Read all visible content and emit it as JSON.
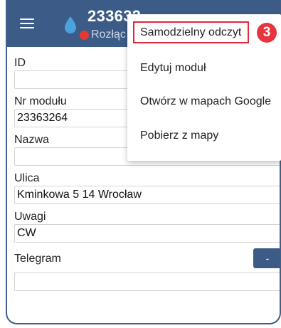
{
  "header": {
    "title": "233632",
    "status": "Rozłąc"
  },
  "form": {
    "id_label": "ID",
    "id_value": "",
    "module_label": "Nr modułu",
    "module_value": "23363264",
    "name_label": "Nazwa",
    "name_value": "",
    "street_label": "Ulica",
    "street_value": "Kminkowa 5 14 Wrocław",
    "notes_label": "Uwagi",
    "notes_value": "CW",
    "telegram_label": "Telegram",
    "telegram_value": "",
    "telegram_button": "-"
  },
  "menu": {
    "items": [
      {
        "label": "Samodzielny odczyt"
      },
      {
        "label": "Edytuj moduł"
      },
      {
        "label": "Otwórz w mapach Google"
      },
      {
        "label": "Pobierz z mapy"
      }
    ]
  },
  "annotation": {
    "badge": "3"
  },
  "colors": {
    "appbar": "#3c5c87",
    "status_dot": "#e53935",
    "highlight": "#e0283a"
  },
  "icons": [
    "hamburger-menu-icon",
    "water-drop-icon",
    "status-dot-icon"
  ]
}
